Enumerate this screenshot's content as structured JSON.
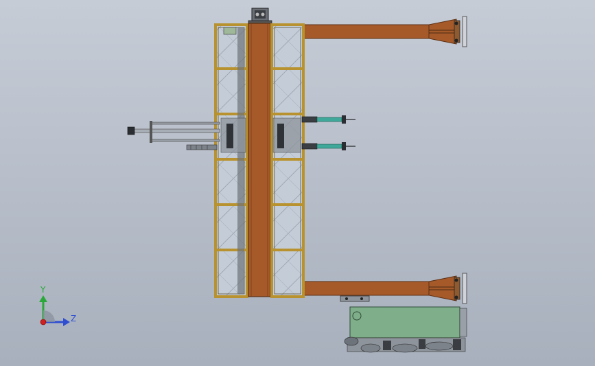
{
  "viewport": {
    "background_top": "#c6ccd6",
    "background_bottom": "#a8b0bd"
  },
  "colors": {
    "beam": "#a65a2a",
    "beam_edge": "#5a2e12",
    "frame": "#b8922e",
    "frame_edge": "#3a2a08",
    "glass": "#c9d2dc",
    "steel": "#8e949c",
    "motor_green": "#7fae8a",
    "cylinder_teal": "#3fa89a",
    "axis_y": "#2aa83a",
    "axis_z": "#2f4fd0",
    "axis_x": "#d02020"
  },
  "triad": {
    "y_label": "Y",
    "z_label": "Z"
  }
}
